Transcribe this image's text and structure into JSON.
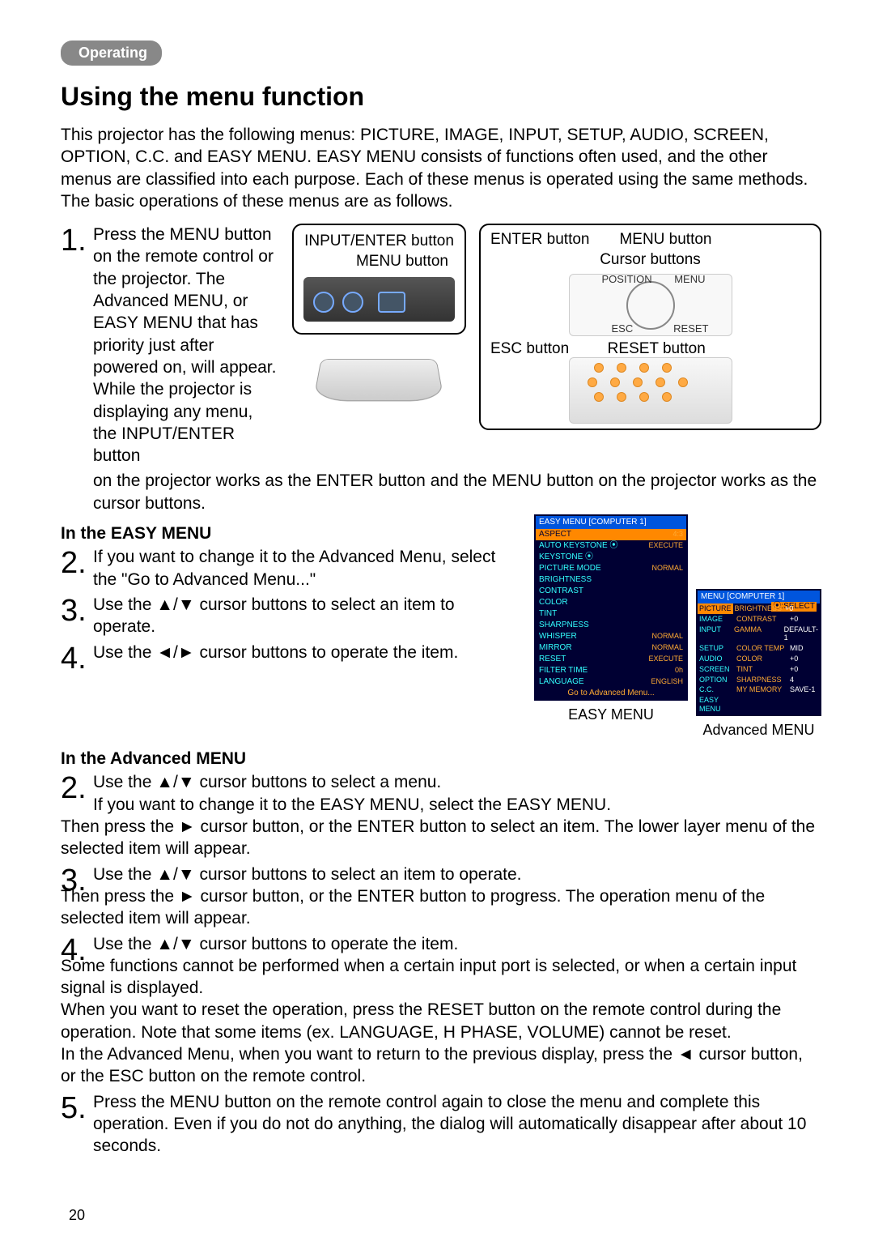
{
  "pill": "Operating",
  "h1": "Using the menu function",
  "intro": "This projector has the following menus: PICTURE, IMAGE, INPUT, SETUP, AUDIO, SCREEN, OPTION, C.C. and EASY MENU. EASY MENU consists of functions often used, and the other menus are classified into each purpose. Each of these menus is operated using the same methods. The basic operations of these menus are as follows.",
  "step1": "Press the MENU button on the remote control or the projector. The Advanced MENU, or EASY MENU that has priority just after powered on, will appear. While the projector is displaying any menu, the INPUT/ENTER button",
  "step1_cont": "on the projector works as the ENTER button and the MENU button on the projector works as the cursor buttons.",
  "box_mid_t": "INPUT/ENTER button",
  "box_mid_b": "MENU button",
  "box_right_t": "ENTER button       MENU button",
  "box_right_m": "Cursor buttons",
  "box_right_e": "ESC button         RESET button",
  "easy_head": "In the EASY MENU",
  "easy2": "If you want to change it to the Advanced Menu, select the \"Go to Advanced Menu...\"",
  "easy3": "Use the ▲/▼ cursor buttons to select an item to operate.",
  "easy4": "Use the ◄/► cursor buttons to operate the item.",
  "adv_head": "In the Advanced MENU",
  "adv2a": "Use the ▲/▼ cursor buttons to select a menu.",
  "adv2b": "If you want to change it to the EASY MENU, select the EASY MENU.",
  "adv2c": "Then press the ► cursor button, or the ENTER button to select an item. The lower layer menu of the selected item will appear.",
  "adv3a": "Use the ▲/▼ cursor buttons to select an item to operate.",
  "adv3b": "Then press the ► cursor button, or the ENTER button to progress. The operation menu of the selected item will appear.",
  "adv4a": "Use the ▲/▼ cursor buttons to operate the item.",
  "adv4b": "Some functions cannot be performed when a certain input port is selected, or when a certain input signal is displayed.",
  "adv4c": "When you want to reset the operation, press the RESET button on the remote control during the operation. Note that some items (ex. LANGUAGE, H PHASE, VOLUME) cannot be reset.",
  "adv4d": "In the Advanced Menu, when you want to return to the previous display, press the ◄ cursor button, or the ESC button on the remote control.",
  "adv5": "Press the MENU button on the remote control again to close the menu and complete this operation. Even if you do not do anything, the dialog will automatically disappear after about 10 seconds.",
  "cap_easy": "EASY MENU",
  "cap_adv": "Advanced MENU",
  "page_num": "20",
  "easy_menu": {
    "title": "EASY MENU [COMPUTER 1]",
    "rows": [
      [
        "ASPECT",
        "4:3",
        "sel"
      ],
      [
        "AUTO KEYSTONE ⦿",
        "EXECUTE",
        ""
      ],
      [
        "KEYSTONE ⦿",
        "",
        ""
      ],
      [
        "PICTURE MODE",
        "NORMAL",
        ""
      ],
      [
        "BRIGHTNESS",
        "",
        ""
      ],
      [
        "CONTRAST",
        "",
        ""
      ],
      [
        "COLOR",
        "",
        ""
      ],
      [
        "TINT",
        "",
        ""
      ],
      [
        "SHARPNESS",
        "",
        ""
      ],
      [
        "WHISPER",
        "NORMAL",
        ""
      ],
      [
        "MIRROR",
        "NORMAL",
        ""
      ],
      [
        "RESET",
        "EXECUTE",
        ""
      ],
      [
        "FILTER TIME",
        "0h",
        ""
      ],
      [
        "LANGUAGE",
        "ENGLISH",
        ""
      ]
    ],
    "footer": "Go to Advanced Menu..."
  },
  "adv_menu": {
    "title": "MENU [COMPUTER 1]",
    "sel_hint": "⦿:SELECT",
    "left": [
      "PICTURE",
      "IMAGE",
      "INPUT",
      "SETUP",
      "AUDIO",
      "SCREEN",
      "OPTION",
      "C.C.",
      "EASY MENU"
    ],
    "mid": [
      "BRIGHTNESS",
      "CONTRAST",
      "GAMMA",
      "COLOR TEMP",
      "COLOR",
      "TINT",
      "SHARPNESS",
      "MY MEMORY"
    ],
    "right": [
      "+0",
      "+0",
      "DEFAULT-1",
      "MID",
      "+0",
      "+0",
      "4",
      "SAVE-1"
    ]
  }
}
